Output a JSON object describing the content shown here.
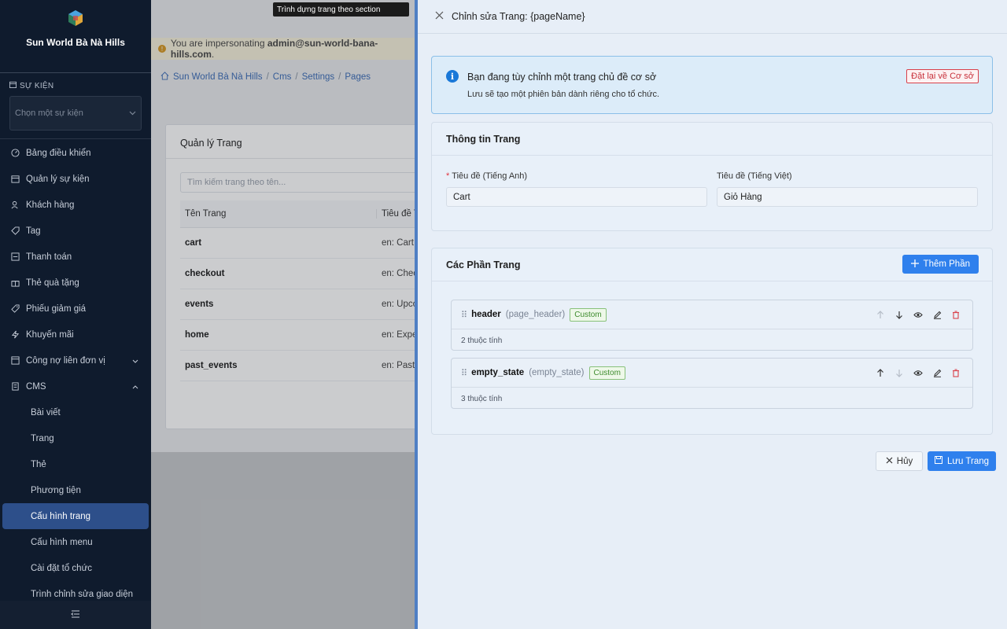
{
  "sidebar": {
    "brand": "Sun World Bà Nà Hills",
    "event_section_label": "SỰ KIỆN",
    "event_select_placeholder": "Chọn một sự kiện",
    "items": [
      {
        "label": "Bảng điều khiển",
        "icon": "gauge-icon"
      },
      {
        "label": "Quản lý sự kiện",
        "icon": "calendar-icon"
      },
      {
        "label": "Khách hàng",
        "icon": "users-icon"
      },
      {
        "label": "Tag",
        "icon": "tag-icon"
      },
      {
        "label": "Thanh toán",
        "icon": "payment-icon"
      },
      {
        "label": "Thẻ quà tặng",
        "icon": "gift-icon"
      },
      {
        "label": "Phiếu giảm giá",
        "icon": "coupon-icon"
      },
      {
        "label": "Khuyến mãi",
        "icon": "lightning-icon"
      },
      {
        "label": "Công nợ liên đơn vị",
        "icon": "ledger-icon"
      },
      {
        "label": "CMS",
        "icon": "document-icon"
      }
    ],
    "cms_sub_items": [
      {
        "label": "Bài viết"
      },
      {
        "label": "Trang"
      },
      {
        "label": "Thẻ"
      },
      {
        "label": "Phương tiện"
      },
      {
        "label": "Cấu hình trang",
        "active": true
      },
      {
        "label": "Cấu hình menu"
      },
      {
        "label": "Cài đặt tổ chức"
      },
      {
        "label": "Trình chỉnh sửa giao diện"
      }
    ]
  },
  "tooltip": "Trình dựng trang theo section",
  "impersonation": {
    "prefix": "You are impersonating",
    "email": "admin@sun-world-bana-hills.com",
    "suffix": "."
  },
  "breadcrumb": [
    "Sun World Bà Nà Hills",
    "Cms",
    "Settings",
    "Pages"
  ],
  "page_manager": {
    "title": "Quản lý Trang",
    "search_placeholder": "Tìm kiếm trang theo tên...",
    "columns": [
      "Tên Trang",
      "Tiêu đề T"
    ],
    "rows": [
      {
        "name": "cart",
        "title": "en: Cart |"
      },
      {
        "name": "checkout",
        "title": "en: Check"
      },
      {
        "name": "events",
        "title": "en: Upco"
      },
      {
        "name": "home",
        "title": "en: Experi"
      },
      {
        "name": "past_events",
        "title": "en: Past E"
      }
    ]
  },
  "drawer": {
    "title": "Chỉnh sửa Trang: {pageName}",
    "info": {
      "title": "Bạn đang tùy chỉnh một trang chủ đề cơ sở",
      "subtitle": "Lưu sẽ tạo một phiên bản dành riêng cho tổ chức.",
      "reset_label": "Đặt lại về Cơ sở"
    },
    "page_info": {
      "heading": "Thông tin Trang",
      "title_en_label": "Tiêu đề (Tiếng Anh)",
      "title_en_value": "Cart",
      "title_vi_label": "Tiêu đề (Tiếng Việt)",
      "title_vi_value": "Giỏ Hàng"
    },
    "sections": {
      "heading": "Các Phần Trang",
      "add_label": "Thêm Phần",
      "items": [
        {
          "name": "header",
          "type": "(page_header)",
          "badge": "Custom",
          "props": "2 thuộc tính"
        },
        {
          "name": "empty_state",
          "type": "(empty_state)",
          "badge": "Custom",
          "props": "3 thuộc tính"
        }
      ]
    },
    "cancel_label": "Hủy",
    "save_label": "Lưu Trang"
  },
  "colors": {
    "sidebar_bg": "#0f1b2d",
    "active_nav": "#2d4f8a",
    "primary": "#2f80ed",
    "danger": "#d9414b",
    "badge_green": "#3d8b2c"
  }
}
